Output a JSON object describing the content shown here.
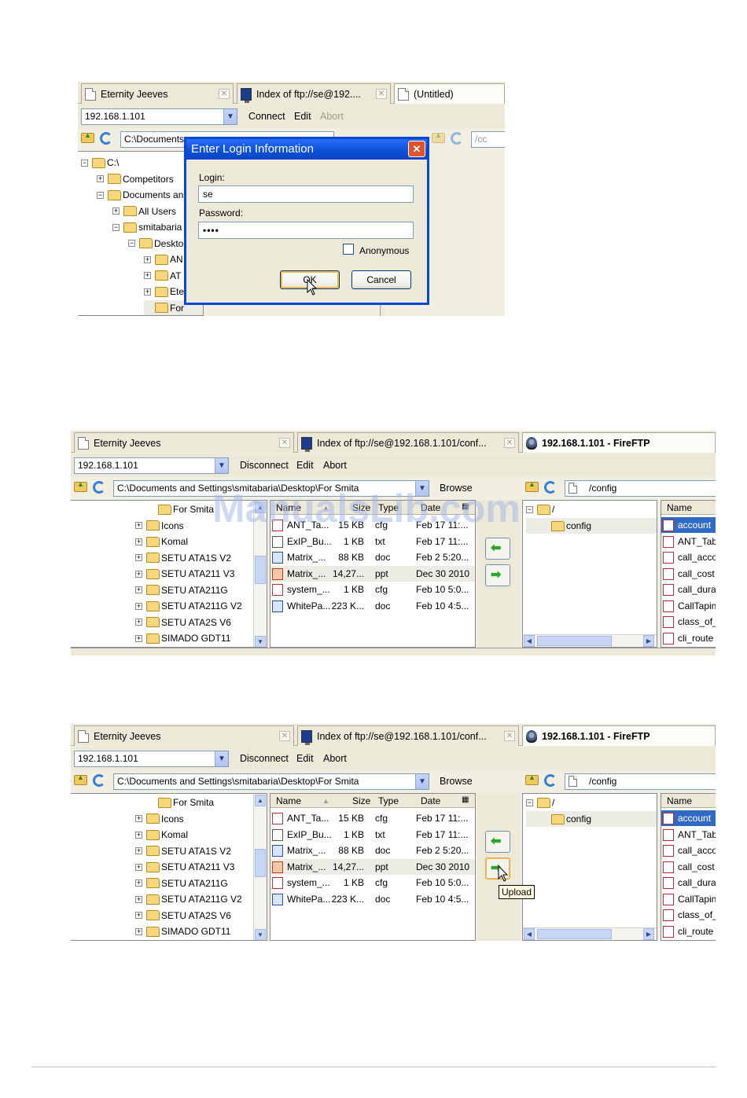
{
  "shot1": {
    "tabs": [
      "Eternity Jeeves",
      "Index of ftp://se@192....",
      "(Untitled)"
    ],
    "address": "192.168.1.101",
    "menu": {
      "connect": "Connect",
      "edit": "Edit",
      "abort": "Abort"
    },
    "local_path": "C:\\Documents",
    "remote_path_fragment": "/cc",
    "tree": [
      {
        "label": "C:\\",
        "sign": "−",
        "indent": 0
      },
      {
        "label": "Competitors",
        "sign": "+",
        "indent": 1
      },
      {
        "label": "Documents an",
        "sign": "−",
        "indent": 1
      },
      {
        "label": "All Users",
        "sign": "+",
        "indent": 2
      },
      {
        "label": "smitabaria",
        "sign": "−",
        "indent": 2
      },
      {
        "label": "Deskto",
        "sign": "−",
        "indent": 3
      },
      {
        "label": "AN",
        "sign": "+",
        "indent": 4
      },
      {
        "label": "AT",
        "sign": "+",
        "indent": 4
      },
      {
        "label": "Ete",
        "sign": "+",
        "indent": 4
      },
      {
        "label": "For",
        "sign": "",
        "indent": 4
      }
    ],
    "dialog": {
      "title": "Enter Login Information",
      "login_label": "Login:",
      "login_value": "se",
      "password_label": "Password:",
      "password_value": "••••",
      "anonymous_label": "Anonymous",
      "ok": "OK",
      "cancel": "Cancel"
    }
  },
  "shot2": {
    "tabs": [
      "Eternity Jeeves",
      "Index of ftp://se@192.168.1.101/conf...",
      "192.168.1.101 - FireFTP"
    ],
    "address": "192.168.1.101",
    "menu": {
      "disconnect": "Disconnect",
      "edit": "Edit",
      "abort": "Abort"
    },
    "local_path": "C:\\Documents and Settings\\smitabaria\\Desktop\\For Smita",
    "browse": "Browse",
    "remote_path": "/config",
    "tree": [
      "For Smita",
      "Icons",
      "Komal",
      "SETU ATA1S V2",
      "SETU ATA211 V3",
      "SETU ATA211G",
      "SETU ATA211G V2",
      "SETU ATA2S V6",
      "SIMADO GDT11"
    ],
    "columns": {
      "name": "Name",
      "size": "Size",
      "type": "Type",
      "date": "Date"
    },
    "files": [
      {
        "name": "ANT_Ta...",
        "size": "15 KB",
        "type": "cfg",
        "date": "Feb 17 11:...",
        "icon": "cfg"
      },
      {
        "name": "ExIP_Bu...",
        "size": "1 KB",
        "type": "txt",
        "date": "Feb 17 11:...",
        "icon": "txt"
      },
      {
        "name": "Matrix_...",
        "size": "88 KB",
        "type": "doc",
        "date": "Feb 2 5:20...",
        "icon": "doc"
      },
      {
        "name": "Matrix_...",
        "size": "14,27...",
        "type": "ppt",
        "date": "Dec 30 2010",
        "icon": "ppt"
      },
      {
        "name": "system_...",
        "size": "1 KB",
        "type": "cfg",
        "date": "Feb 10 5:0...",
        "icon": "cfg"
      },
      {
        "name": "WhitePa...",
        "size": "223 K...",
        "type": "doc",
        "date": "Feb 10 4:5...",
        "icon": "doc"
      }
    ],
    "remote_tree": [
      "/",
      "config"
    ],
    "remote_col": "Name",
    "remote_files": [
      "account",
      "ANT_Tab",
      "call_acco",
      "call_cost",
      "call_dura",
      "CallTapin",
      "class_of_",
      "cli_route"
    ],
    "watermark": "ManualsLib.com"
  },
  "shot3": {
    "tooltip": "Upload"
  }
}
